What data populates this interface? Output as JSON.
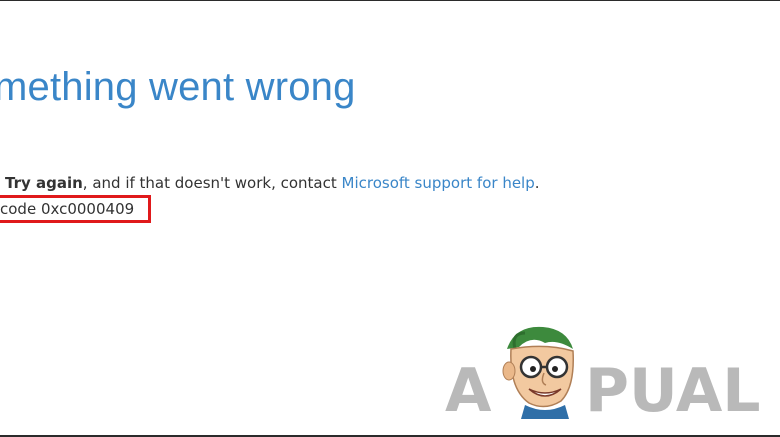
{
  "error": {
    "heading": "mething went wrong",
    "message_prefix": "",
    "try_again_label": "Try again",
    "message_middle": ", and if that doesn't work, contact ",
    "support_link": "Microsoft support for help",
    "message_suffix": ".",
    "code_text": "code 0xc0000409"
  },
  "watermark": {
    "text": "APPUALS"
  },
  "colors": {
    "accent": "#3a86c8",
    "highlight_box": "#e0191b",
    "body_text": "#333333",
    "watermark": "#b9b9b9"
  }
}
